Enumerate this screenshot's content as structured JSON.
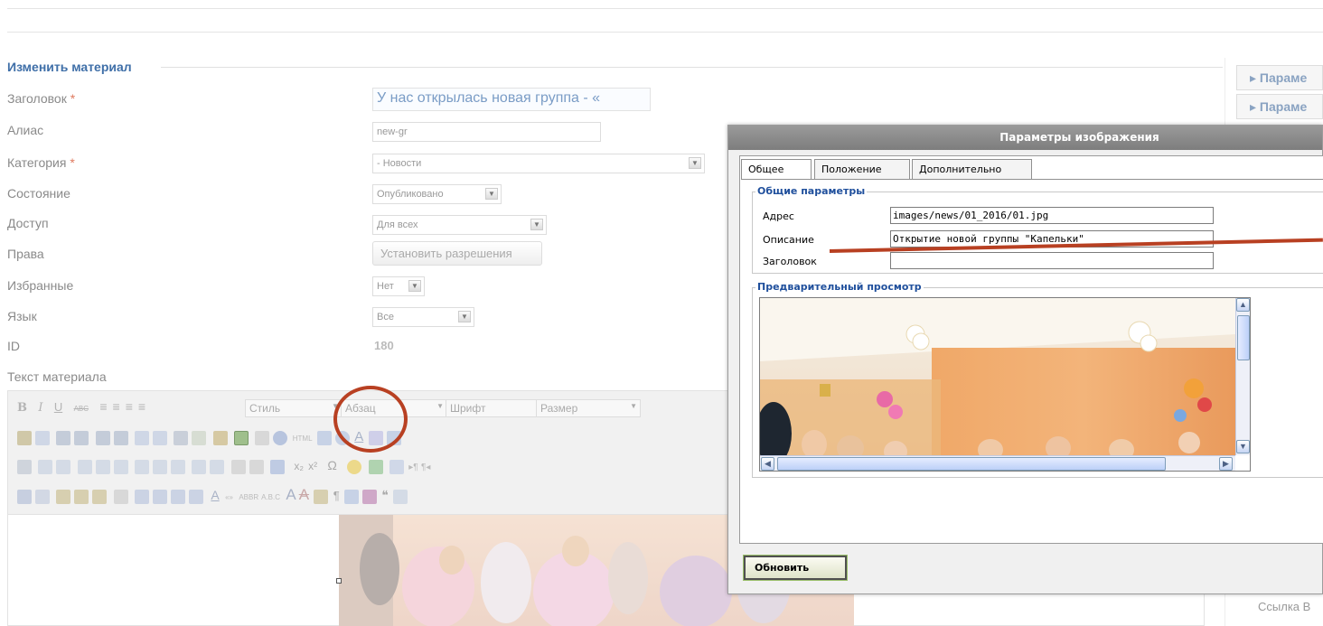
{
  "form": {
    "legend": "Изменить материал",
    "labels": {
      "title": "Заголовок",
      "alias": "Алиас",
      "category": "Категория",
      "state": "Состояние",
      "access": "Доступ",
      "rights": "Права",
      "featured": "Избранные",
      "language": "Язык",
      "id": "ID",
      "text": "Текст материала"
    },
    "required_mark": "*",
    "values": {
      "title": "У нас открылась новая группа  - «",
      "alias": "new-gr",
      "category": "- Новости",
      "state": "Опубликовано",
      "access": "Для всех",
      "rights_button": "Установить разрешения",
      "featured": "Нет",
      "language": "Все",
      "id": "180"
    }
  },
  "editor_toolbar": {
    "style": "Стиль",
    "paragraph": "Абзац",
    "font": "Шрифт",
    "size": "Размер"
  },
  "sidebar": {
    "params1": "▸ Параме",
    "params2": "▸ Параме",
    "link": "Ссылка В"
  },
  "dialog": {
    "title": "Параметры изображения",
    "tabs": [
      "Общее",
      "Положение",
      "Дополнительно"
    ],
    "active_tab": "Общее",
    "general_group": "Общие параметры",
    "address_label": "Адрес",
    "address_value": "images/news/01_2016/01.jpg",
    "description_label": "Описание",
    "description_value": "Открытие новой группы \"Капельки\"",
    "heading_label": "Заголовок",
    "heading_value": "",
    "preview_group": "Предварительный просмотр",
    "update_button": "Обновить"
  },
  "colors": {
    "annotation": "#b84022",
    "accent": "#3f6fa8"
  }
}
